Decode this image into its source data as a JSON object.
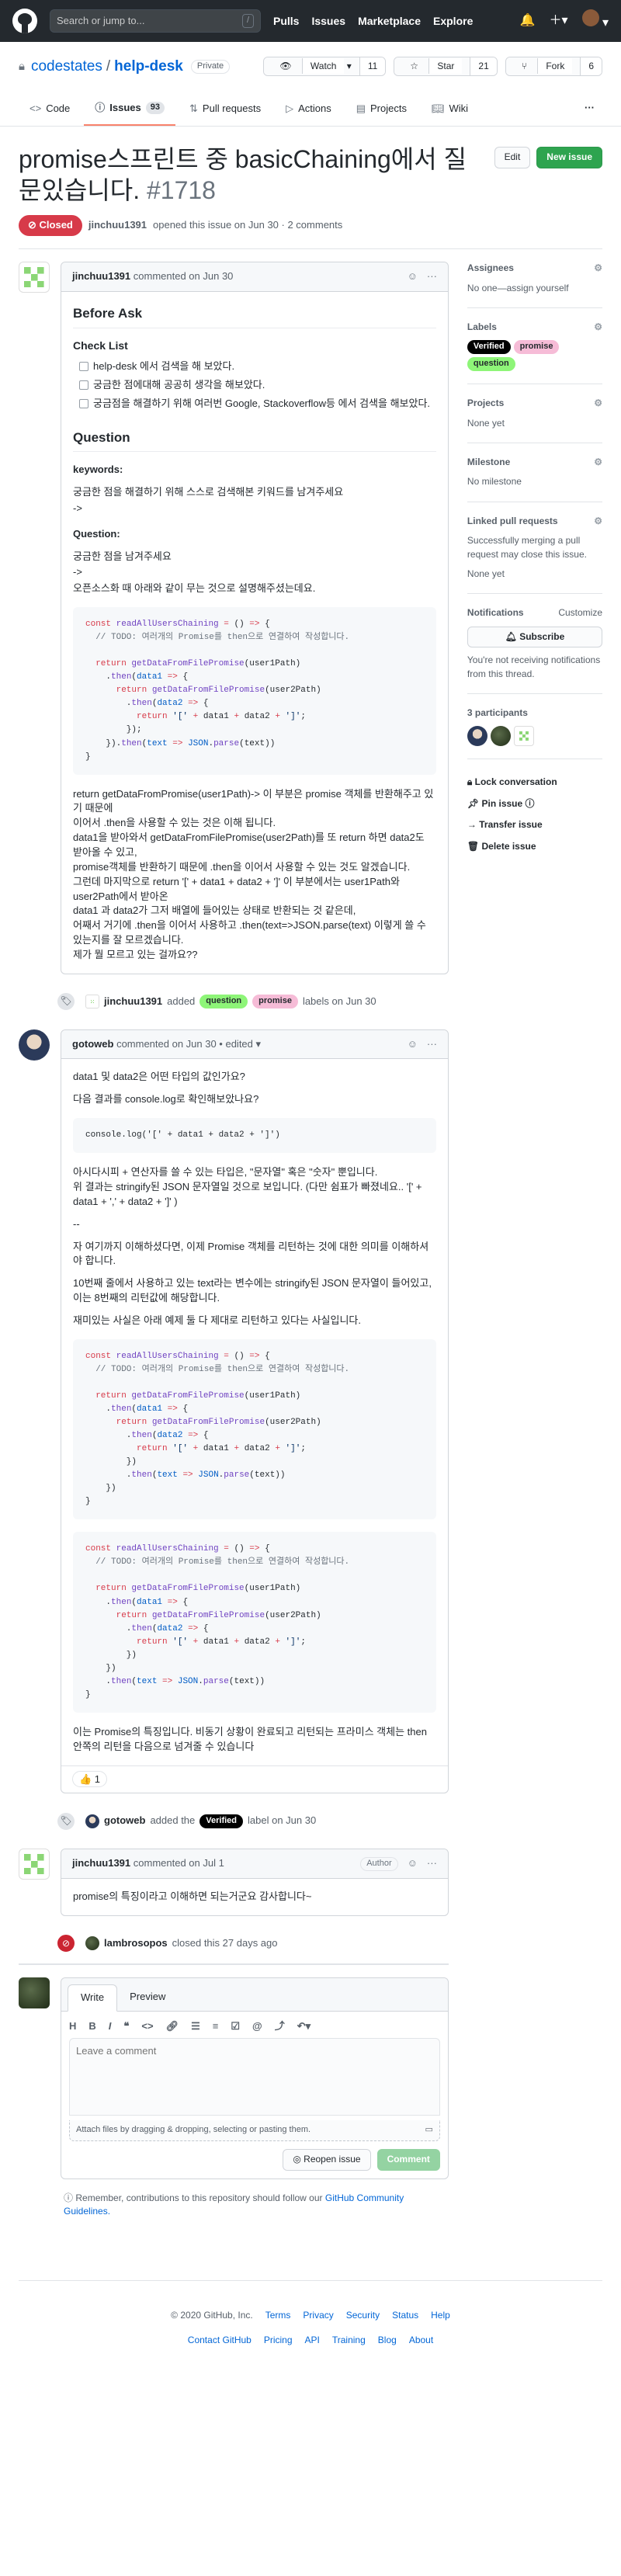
{
  "header": {
    "search_placeholder": "Search or jump to...",
    "slash_key": "/",
    "nav": [
      "Pulls",
      "Issues",
      "Marketplace",
      "Explore"
    ]
  },
  "repo": {
    "owner": "codestates",
    "separator": "/",
    "name": "help-desk",
    "visibility": "Private",
    "watch_label": "Watch",
    "watch_count": "11",
    "star_label": "Star",
    "star_count": "21",
    "fork_label": "Fork",
    "fork_count": "6"
  },
  "tabs": [
    {
      "label": "Code",
      "icon": "code-icon"
    },
    {
      "label": "Issues",
      "count": "93",
      "icon": "issue-icon"
    },
    {
      "label": "Pull requests",
      "icon": "pr-icon"
    },
    {
      "label": "Actions",
      "icon": "play-icon"
    },
    {
      "label": "Projects",
      "icon": "project-icon"
    },
    {
      "label": "Wiki",
      "icon": "book-icon"
    }
  ],
  "issue": {
    "title": "promise스프린트 중 basicChaining에서 질문있습니다.",
    "number": "#1718",
    "state": "Closed",
    "edit_label": "Edit",
    "new_issue_label": "New issue",
    "author": "jinchuu1391",
    "meta_text": "opened this issue on Jun 30 · 2 comments"
  },
  "comments": [
    {
      "author": "jinchuu1391",
      "meta": "commented on Jun 30",
      "h_before": "Before Ask",
      "h_checklist": "Check List",
      "tasks": [
        "help-desk 에서 검색을 해 보았다.",
        "궁금한 점에대해 공공히 생각을 해보았다.",
        "궁금점을 해결하기 위해 여러번 Google, Stackoverflow등 에서 검색을 해보았다."
      ],
      "h_question": "Question",
      "keywords_label": "keywords:",
      "keywords_text": "궁금한 점을 해결하기 위해 스스로 검색해본 키워드를 남겨주세요",
      "arrow1": "->",
      "question_label": "Question:",
      "question_text": "궁금한 점을 남겨주세요",
      "arrow2": "->",
      "question_hint": "오픈소스화 때 아래와 같이 무는 것으로 설명해주셨는데요.",
      "body_lines": [
        "return getDataFromPromise(user1Path)-> 이 부분은 promise 객체를 반환해주고 있기 때문에",
        "이어서 .then을 사용할 수 있는 것은 이해 됩니다.",
        "data1을 받아와서 getDataFromFilePromise(user2Path)를 또 return 하면 data2도 받아올 수 있고,",
        "promise객체를 반환하기 때문에 .then을 이어서 사용할 수 있는 것도 알겠습니다.",
        "그런데 마지막으로 return '[' + data1 + data2 + ']' 이 부분에서는 user1Path와 user2Path에서 받아온",
        "data1 과 data2가 그저 배열에 들어있는 상태로 반환되는 것 같은데,",
        "어째서 거기에 .then을 이어서 사용하고 .then(text=>JSON.parse(text) 이렇게 쓸 수 있는지를 잘 모르겠습니다.",
        "제가 뭘 모르고 있는 걸까요??"
      ]
    },
    {
      "author": "gotoweb",
      "meta": "commented on Jun 30 • edited",
      "p1": "data1 및 data2은 어떤 타입의 값인가요?",
      "p2": "다음 결과를 console.log로 확인해보았나요?",
      "code_inline": "console.log('[' + data1 + data2 + ']')",
      "p3a": "아시다시피 + 연산자를 쓸 수 있는 타입은, \"문자열\" 혹은 \"숫자\" 뿐입니다.",
      "p3b": "위 결과는 stringify된 JSON 문자열일 것으로 보입니다. (다만 쉼표가 빠졌네요.. '[' + data1 + ',' + data2 + ']' )",
      "sep": "--",
      "p4": "자 여기까지 이해하셨다면, 이제 Promise 객체를 리턴하는 것에 대한 의미를 이해하셔야 합니다.",
      "p5": "10번째 줄에서 사용하고 있는 text라는 변수에는 stringify된 JSON 문자열이 들어있고, 이는 8번째의 리턴값에 해당합니다.",
      "p6": "재미있는 사실은 아래 예제 둘 다 제대로 리턴하고 있다는 사실입니다.",
      "p7": "이는 Promise의 특징입니다. 비동기 상황이 완료되고 리턴되는 프라미스 객체는 then 안쪽의 리턴을 다음으로 넘겨줄 수 있습니다",
      "reaction": "👍 1"
    },
    {
      "author": "jinchuu1391",
      "meta": "commented on Jul 1",
      "badge": "Author",
      "text": "promise의 특징이라고 이해하면 되는거군요 감사합니다~"
    }
  ],
  "events": [
    {
      "actor": "jinchuu1391",
      "action": "added",
      "labels": [
        "question",
        "promise"
      ],
      "suffix": "labels on Jun 30"
    },
    {
      "actor": "gotoweb",
      "action": "added the",
      "labels": [
        "Verified"
      ],
      "suffix": "label on Jun 30"
    },
    {
      "actor": "lambrosopos",
      "action": "closed this 27 days ago"
    }
  ],
  "new_comment": {
    "tab_write": "Write",
    "tab_preview": "Preview",
    "placeholder": "Leave a comment",
    "attach_text": "Attach files by dragging & dropping, selecting or pasting them.",
    "reopen_label": "Reopen issue",
    "comment_label": "Comment",
    "remember_text": "Remember, contributions to this repository should follow our",
    "remember_link": "GitHub Community Guidelines."
  },
  "sidebar": {
    "assignees_h": "Assignees",
    "assignees_v": "No one—assign yourself",
    "labels_h": "Labels",
    "labels": [
      "Verified",
      "promise",
      "question"
    ],
    "projects_h": "Projects",
    "projects_v": "None yet",
    "milestone_h": "Milestone",
    "milestone_v": "No milestone",
    "linked_h": "Linked pull requests",
    "linked_desc": "Successfully merging a pull request may close this issue.",
    "linked_v": "None yet",
    "notifications_h": "Notifications",
    "customize": "Customize",
    "subscribe_label": "Subscribe",
    "notif_desc": "You're not receiving notifications from this thread.",
    "participants_h": "3 participants",
    "actions": [
      "Lock conversation",
      "Pin issue",
      "Transfer issue",
      "Delete issue"
    ]
  },
  "footer": {
    "copyright": "© 2020 GitHub, Inc.",
    "row1": [
      "Terms",
      "Privacy",
      "Security",
      "Status",
      "Help"
    ],
    "row2": [
      "Contact GitHub",
      "Pricing",
      "API",
      "Training",
      "Blog",
      "About"
    ]
  },
  "colors": {
    "header_bg": "#24292e",
    "closed_red": "#d73a49",
    "green_button": "#2ea44f",
    "link_blue": "#0366d6",
    "label_question": "#8ef578",
    "label_promise": "#f6bcd7",
    "label_verified": "#000000"
  }
}
